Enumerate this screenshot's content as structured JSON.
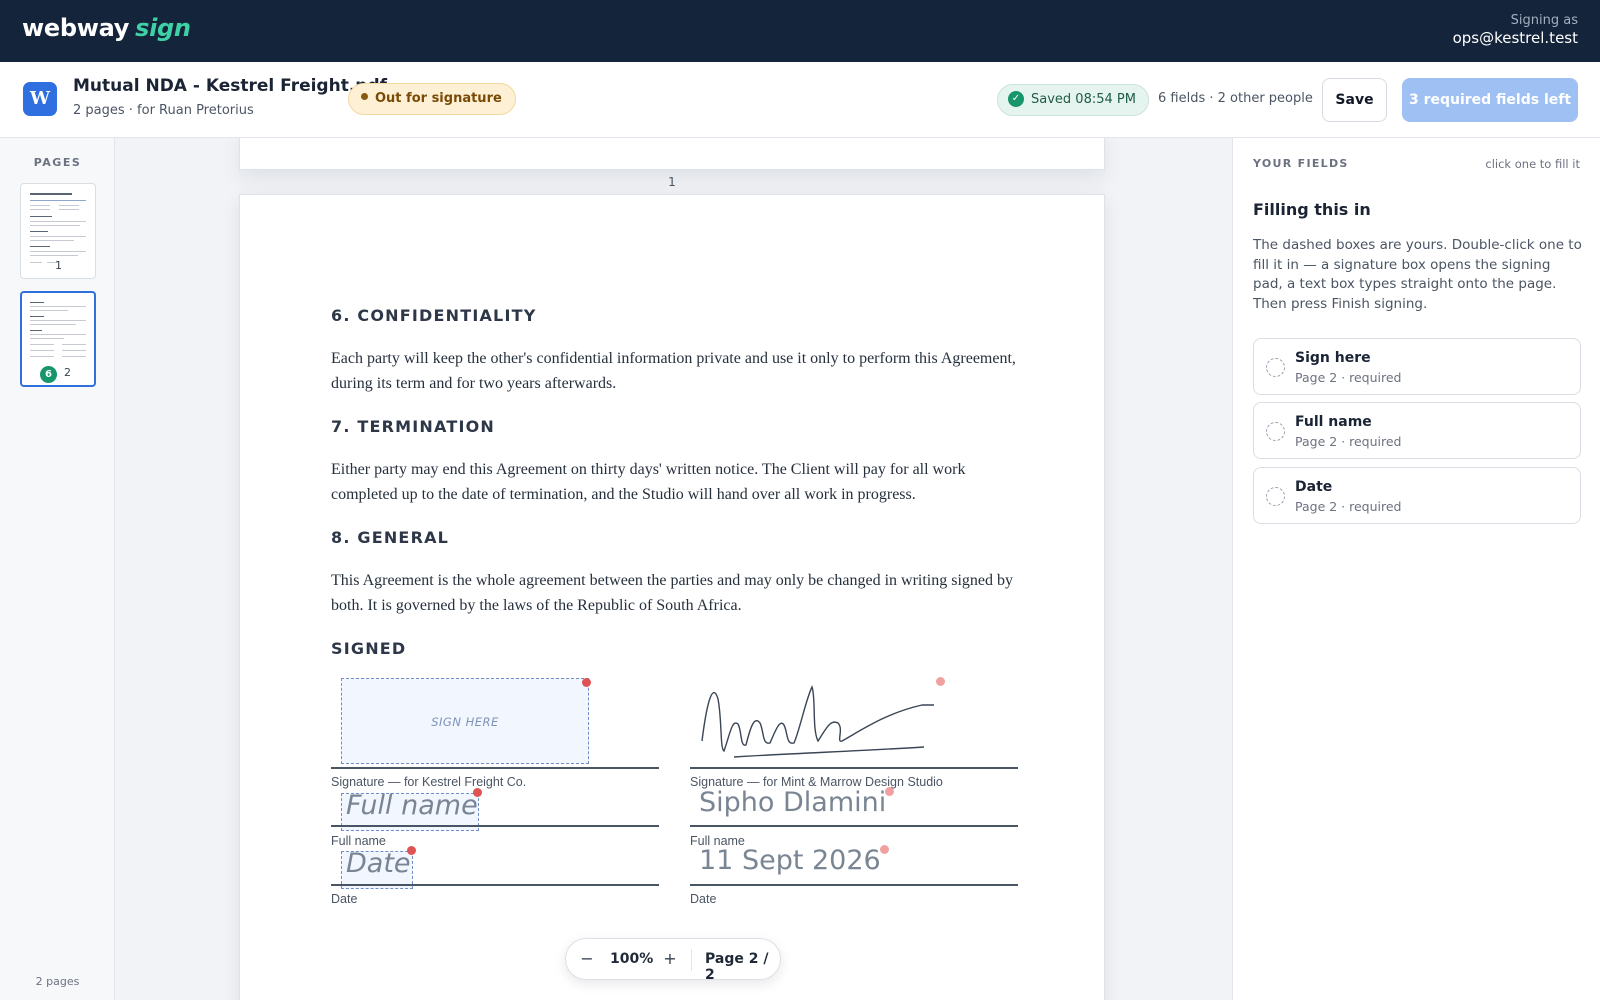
{
  "app": {
    "brand_name": "webway",
    "brand_accent": "sign",
    "signing_as_label": "Signing as",
    "signing_as_email": "ops@kestrel.test"
  },
  "document": {
    "logo_letter": "W",
    "title": "Mutual NDA - Kestrel Freight.pdf",
    "subtitle": "2 pages · for Ruan Pretorius",
    "status": "Out for signature",
    "saved": "Saved 08:54 PM",
    "fields_meta": "6 fields · 2 other people",
    "save_label": "Save",
    "finish_label": "3 required fields left"
  },
  "pages_rail": {
    "title": "PAGES",
    "thumbs": [
      {
        "number": "1"
      },
      {
        "number": "2",
        "badge": "6"
      }
    ],
    "footer": "2 pages"
  },
  "canvas": {
    "prev_page_number": "1",
    "sections": [
      {
        "heading": "6. CONFIDENTIALITY",
        "body": "Each party will keep the other's confidential information private and use it only to perform this Agreement, during its term and for two years afterwards."
      },
      {
        "heading": "7. TERMINATION",
        "body": "Either party may end this Agreement on thirty days' written notice. The Client will pay for all work completed up to the date of termination, and the Studio will hand over all work in progress."
      },
      {
        "heading": "8. GENERAL",
        "body": "This Agreement is the whole agreement between the parties and may only be changed in writing signed by both. It is governed by the laws of the Republic of South Africa."
      }
    ],
    "signed_heading": "SIGNED",
    "left": {
      "sign_placeholder": "SIGN HERE",
      "signature_caption": "Signature — for Kestrel Freight Co.",
      "name_placeholder": "Full name",
      "name_caption": "Full name",
      "date_placeholder": "Date",
      "date_caption": "Date"
    },
    "right": {
      "signature_caption": "Signature — for Mint & Marrow Design Studio",
      "name_value": "Sipho Dlamini",
      "name_caption": "Full name",
      "date_value": "11 Sept 2026",
      "date_caption": "Date"
    },
    "zoom": {
      "minus": "−",
      "value": "100%",
      "plus": "+",
      "page_indicator": "Page 2 / 2"
    }
  },
  "right_panel": {
    "header": "YOUR FIELDS",
    "hint": "click one to fill it",
    "title": "Filling this in",
    "description": "The dashed boxes are yours. Double-click one to fill it in — a signature box opens the signing pad, a text box types straight onto the page. Then press Finish signing.",
    "fields": [
      {
        "name": "Sign here",
        "meta": "Page 2 · required"
      },
      {
        "name": "Full name",
        "meta": "Page 2 · required"
      },
      {
        "name": "Date",
        "meta": "Page 2 · required"
      }
    ]
  },
  "colors": {
    "topbar": "#13243b",
    "brand_accent": "#3fd0a5",
    "primary": "#2f6fe0",
    "finish_disabled": "#9fc0f3",
    "saved_green": "#17956b",
    "status_amber": "#fdf0d5",
    "field_marker": "#e05353"
  }
}
